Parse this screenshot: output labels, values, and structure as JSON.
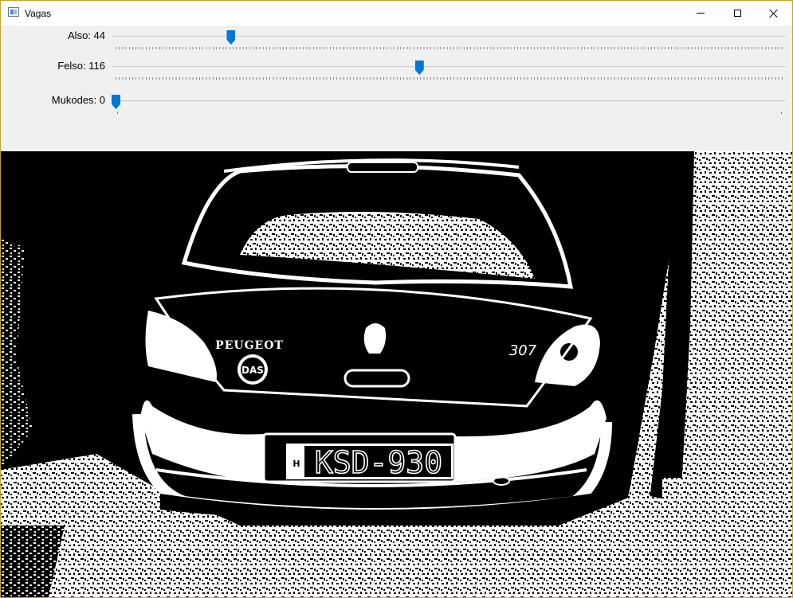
{
  "window": {
    "title": "Vagas",
    "icon": "app-window-icon",
    "buttons": [
      "minimize-icon",
      "maximize-icon",
      "close-icon"
    ],
    "frame_color": "#c9a227"
  },
  "trackbars": [
    {
      "label": "Also: 44",
      "value": 44,
      "max": 255,
      "ticks": "dense"
    },
    {
      "label": "Felso: 116",
      "value": 116,
      "max": 255,
      "ticks": "dense"
    },
    {
      "label": "Mukodes: 0",
      "value": 0,
      "max": 1,
      "ticks": "sparse"
    }
  ],
  "accent_color": "#0078d7",
  "image": {
    "badge_text": "DAS",
    "brand_text": "PEUGEOT",
    "model_text": "307",
    "plate_country": "H",
    "plate_text": "KSD-930"
  }
}
